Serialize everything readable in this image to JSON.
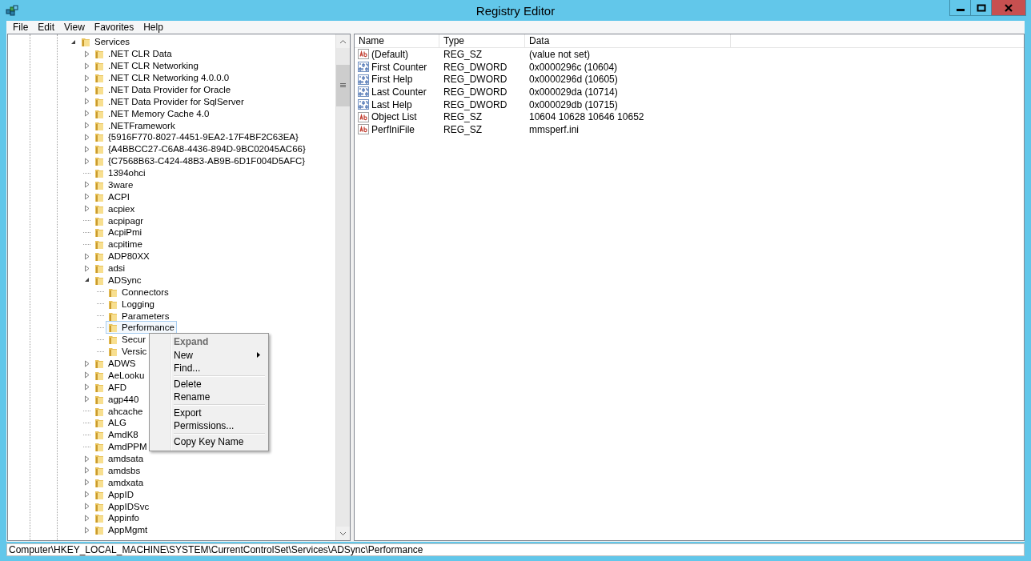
{
  "window": {
    "title": "Registry Editor"
  },
  "menu_bar": [
    "File",
    "Edit",
    "View",
    "Favorites",
    "Help"
  ],
  "tree": {
    "items": [
      {
        "label": "Services",
        "expandable": true,
        "expanded": true,
        "selected": false,
        "children": [
          {
            "label": ".NET CLR Data",
            "expandable": true,
            "expanded": false,
            "selected": false
          },
          {
            "label": ".NET CLR Networking",
            "expandable": true,
            "expanded": false,
            "selected": false
          },
          {
            "label": ".NET CLR Networking 4.0.0.0",
            "expandable": true,
            "expanded": false,
            "selected": false
          },
          {
            "label": ".NET Data Provider for Oracle",
            "expandable": true,
            "expanded": false,
            "selected": false
          },
          {
            "label": ".NET Data Provider for SqlServer",
            "expandable": true,
            "expanded": false,
            "selected": false
          },
          {
            "label": ".NET Memory Cache 4.0",
            "expandable": true,
            "expanded": false,
            "selected": false
          },
          {
            "label": ".NETFramework",
            "expandable": true,
            "expanded": false,
            "selected": false
          },
          {
            "label": "{5916F770-8027-4451-9EA2-17F4BF2C63EA}",
            "expandable": true,
            "expanded": false,
            "selected": false
          },
          {
            "label": "{A4BBCC27-C6A8-4436-894D-9BC02045AC66}",
            "expandable": true,
            "expanded": false,
            "selected": false
          },
          {
            "label": "{C7568B63-C424-48B3-AB9B-6D1F004D5AFC}",
            "expandable": true,
            "expanded": false,
            "selected": false
          },
          {
            "label": "1394ohci",
            "expandable": false,
            "expanded": false,
            "selected": false
          },
          {
            "label": "3ware",
            "expandable": true,
            "expanded": false,
            "selected": false
          },
          {
            "label": "ACPI",
            "expandable": true,
            "expanded": false,
            "selected": false
          },
          {
            "label": "acpiex",
            "expandable": true,
            "expanded": false,
            "selected": false
          },
          {
            "label": "acpipagr",
            "expandable": false,
            "expanded": false,
            "selected": false
          },
          {
            "label": "AcpiPmi",
            "expandable": false,
            "expanded": false,
            "selected": false
          },
          {
            "label": "acpitime",
            "expandable": false,
            "expanded": false,
            "selected": false
          },
          {
            "label": "ADP80XX",
            "expandable": true,
            "expanded": false,
            "selected": false
          },
          {
            "label": "adsi",
            "expandable": true,
            "expanded": false,
            "selected": false
          },
          {
            "label": "ADSync",
            "expandable": true,
            "expanded": true,
            "selected": false,
            "children": [
              {
                "label": "Connectors",
                "expandable": false,
                "expanded": false,
                "selected": false
              },
              {
                "label": "Logging",
                "expandable": false,
                "expanded": false,
                "selected": false
              },
              {
                "label": "Parameters",
                "expandable": false,
                "expanded": false,
                "selected": false
              },
              {
                "label": "Performance",
                "expandable": false,
                "expanded": false,
                "selected": true
              },
              {
                "label": "Secur",
                "expandable": false,
                "expanded": false,
                "selected": false
              },
              {
                "label": "Versic",
                "expandable": false,
                "expanded": false,
                "selected": false
              }
            ]
          },
          {
            "label": "ADWS",
            "expandable": true,
            "expanded": false,
            "selected": false
          },
          {
            "label": "AeLooku",
            "expandable": true,
            "expanded": false,
            "selected": false
          },
          {
            "label": "AFD",
            "expandable": true,
            "expanded": false,
            "selected": false
          },
          {
            "label": "agp440",
            "expandable": true,
            "expanded": false,
            "selected": false
          },
          {
            "label": "ahcache",
            "expandable": false,
            "expanded": false,
            "selected": false
          },
          {
            "label": "ALG",
            "expandable": false,
            "expanded": false,
            "selected": false
          },
          {
            "label": "AmdK8",
            "expandable": false,
            "expanded": false,
            "selected": false
          },
          {
            "label": "AmdPPM",
            "expandable": false,
            "expanded": false,
            "selected": false
          },
          {
            "label": "amdsata",
            "expandable": true,
            "expanded": false,
            "selected": false
          },
          {
            "label": "amdsbs",
            "expandable": true,
            "expanded": false,
            "selected": false
          },
          {
            "label": "amdxata",
            "expandable": true,
            "expanded": false,
            "selected": false
          },
          {
            "label": "AppID",
            "expandable": true,
            "expanded": false,
            "selected": false
          },
          {
            "label": "AppIDSvc",
            "expandable": true,
            "expanded": false,
            "selected": false
          },
          {
            "label": "Appinfo",
            "expandable": true,
            "expanded": false,
            "selected": false
          },
          {
            "label": "AppMgmt",
            "expandable": true,
            "expanded": false,
            "selected": false
          }
        ]
      }
    ]
  },
  "values_list": {
    "columns": [
      "Name",
      "Type",
      "Data"
    ],
    "rows": [
      {
        "kind": "string",
        "name": "(Default)",
        "type": "REG_SZ",
        "data": "(value not set)"
      },
      {
        "kind": "binary",
        "name": "First Counter",
        "type": "REG_DWORD",
        "data": "0x0000296c (10604)"
      },
      {
        "kind": "binary",
        "name": "First Help",
        "type": "REG_DWORD",
        "data": "0x0000296d (10605)"
      },
      {
        "kind": "binary",
        "name": "Last Counter",
        "type": "REG_DWORD",
        "data": "0x000029da (10714)"
      },
      {
        "kind": "binary",
        "name": "Last Help",
        "type": "REG_DWORD",
        "data": "0x000029db (10715)"
      },
      {
        "kind": "string",
        "name": "Object List",
        "type": "REG_SZ",
        "data": "10604 10628 10646 10652"
      },
      {
        "kind": "string",
        "name": "PerfIniFile",
        "type": "REG_SZ",
        "data": "mmsperf.ini"
      }
    ]
  },
  "context_menu": {
    "items": [
      {
        "kind": "item",
        "label": "Expand",
        "disabled": true,
        "default": true,
        "submenu": false
      },
      {
        "kind": "item",
        "label": "New",
        "disabled": false,
        "default": false,
        "submenu": true
      },
      {
        "kind": "item",
        "label": "Find...",
        "disabled": false,
        "default": false,
        "submenu": false
      },
      {
        "kind": "separator"
      },
      {
        "kind": "item",
        "label": "Delete",
        "disabled": false,
        "default": false,
        "submenu": false
      },
      {
        "kind": "item",
        "label": "Rename",
        "disabled": false,
        "default": false,
        "submenu": false
      },
      {
        "kind": "separator"
      },
      {
        "kind": "item",
        "label": "Export",
        "disabled": false,
        "default": false,
        "submenu": false
      },
      {
        "kind": "item",
        "label": "Permissions...",
        "disabled": false,
        "default": false,
        "submenu": false
      },
      {
        "kind": "separator"
      },
      {
        "kind": "item",
        "label": "Copy Key Name",
        "disabled": false,
        "default": false,
        "submenu": false
      }
    ]
  },
  "status_bar": "Computer\\HKEY_LOCAL_MACHINE\\SYSTEM\\CurrentControlSet\\Services\\ADSync\\Performance"
}
